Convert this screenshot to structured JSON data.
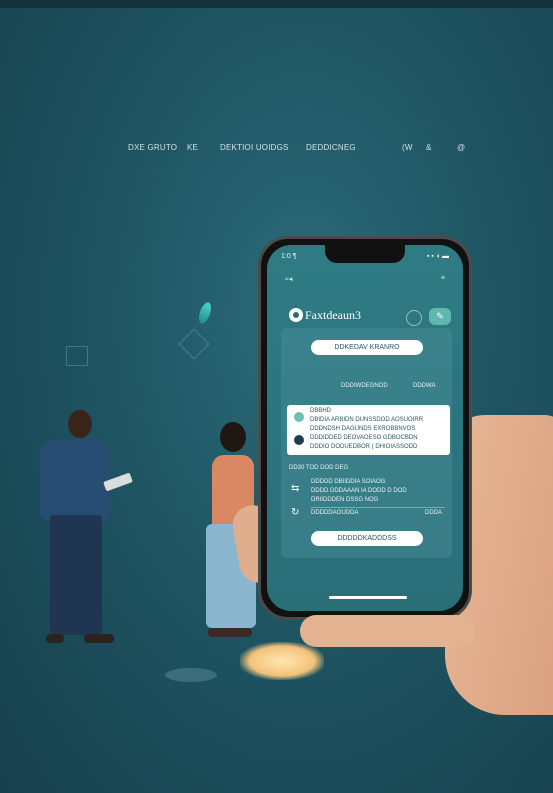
{
  "nav": {
    "items": [
      "DXE GRUTO",
      "KE",
      "DEKTIOI UOIDGS",
      "DEDDICNEG",
      "(W",
      "&",
      "@"
    ]
  },
  "phone": {
    "status_time": "1:0 ¶",
    "status_right": "▪ ▪ ◖ ▬",
    "menu_text": "≈◂",
    "menu_right": "≡",
    "app_title": "Faxtdeaun3",
    "app_action_icon": "edit-icon",
    "pill_top": "DDKEDAV KRANRO",
    "row_mid_left": "DDDIWDEGNOD",
    "row_mid_right": "DDDWA",
    "card_lines": [
      "DBBHD",
      "DBIDIA ARBIDN DUNSSDOD AOSUOIRR",
      "DDDNDSH DAGUNDS EXROBBNVOS",
      "DDDIDDED DEOVAOESO GDBOCBDN",
      "DDDIO DODUEDBOR ( DHIOIASSODD"
    ],
    "section_label": "DD30      TOD DOD DEG",
    "list_lines": [
      "DDDDD DBIIDDIA SOIAOG",
      "DDDD DDDAAAN IA DODD D DOD",
      "DRIIDDDEN DSSG NOG"
    ],
    "row_bottom_left": "DDDDDAOUDDA",
    "row_bottom_right": "DDDA",
    "pill_bottom": "DDDDDKADDDSS",
    "accent": "#5fb8ae",
    "screen_bg": "#2a6e78"
  }
}
